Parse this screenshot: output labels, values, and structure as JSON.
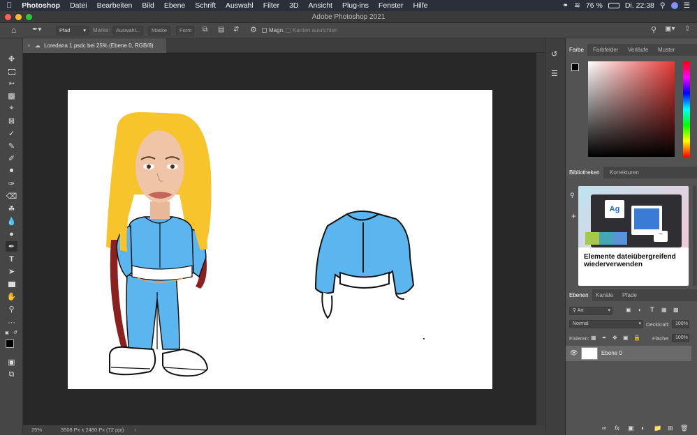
{
  "menubar": {
    "app": "Photoshop",
    "items": [
      "Datei",
      "Bearbeiten",
      "Bild",
      "Ebene",
      "Schrift",
      "Auswahl",
      "Filter",
      "3D",
      "Ansicht",
      "Plug-ins",
      "Fenster",
      "Hilfe"
    ],
    "battery": "76 %",
    "clock": "Di. 22:38"
  },
  "window": {
    "title": "Adobe Photoshop 2021"
  },
  "options": {
    "mode": "Pfad",
    "marke_label": "Marke:",
    "auswahl": "Auswahl...",
    "maske": "Maske",
    "form": "Form",
    "magn_label": "Magn.",
    "kanten": "Kanten ausrichten"
  },
  "document": {
    "tab_title": "Loredana 1.psdc bei 25% (Ebene 0, RGB/8)"
  },
  "status": {
    "zoom": "25%",
    "size": "3508 Px x 2480 Px (72 ppi)"
  },
  "color_panel": {
    "tabs": [
      "Farbe",
      "Farbfelder",
      "Verläufe",
      "Muster"
    ],
    "hue_color": "#e53935"
  },
  "libraries_panel": {
    "tabs": [
      "Bibliotheken",
      "Korrekturen"
    ],
    "card_title": "Elemente dateiübergreifend wiederverwenden",
    "card_tile_text": "Ag"
  },
  "layers_panel": {
    "tabs": [
      "Ebenen",
      "Kanäle",
      "Pfade"
    ],
    "filter": "Art",
    "blend_mode": "Normal",
    "opacity_label": "Deckkraft:",
    "opacity": "100%",
    "lock_label": "Fixieren:",
    "fill_label": "Fläche:",
    "fill": "100%",
    "layers": [
      {
        "name": "Ebene 0",
        "visible": true
      }
    ]
  }
}
